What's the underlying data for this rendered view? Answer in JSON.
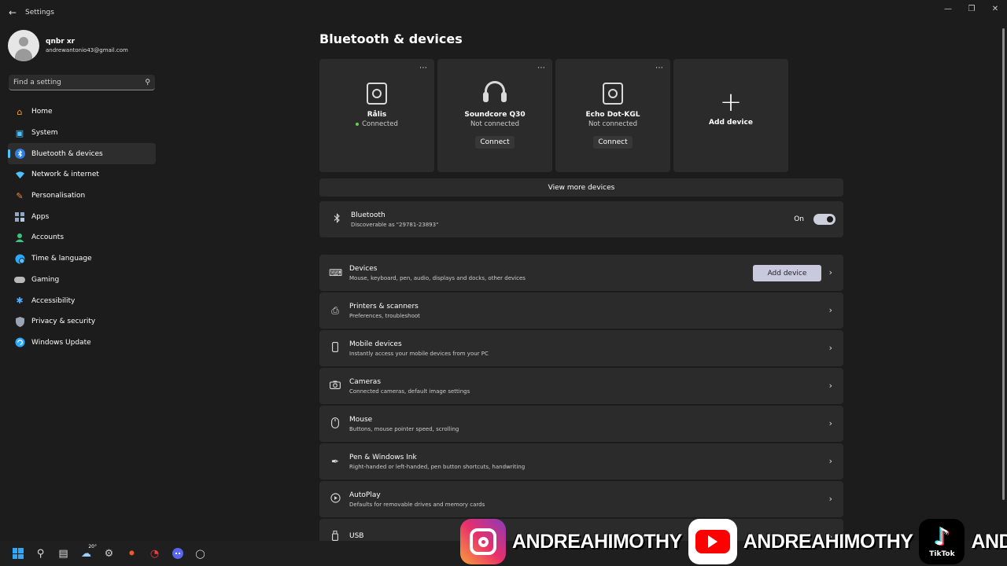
{
  "window": {
    "title": "Settings",
    "back_icon": "back-arrow-icon",
    "controls": [
      "minimize-icon",
      "maximize-icon",
      "close-icon"
    ]
  },
  "profile": {
    "name": "qnbr xr",
    "email": "andrewantonio43@gmail.com"
  },
  "search": {
    "placeholder": "Find a setting"
  },
  "sidebar": {
    "items": [
      {
        "label": "Home",
        "icon": "home-icon",
        "color": "#f0a030"
      },
      {
        "label": "System",
        "icon": "system-icon",
        "color": "#4cc2ff"
      },
      {
        "label": "Bluetooth & devices",
        "icon": "bluetooth-icon",
        "color": "#4c9fff",
        "active": true
      },
      {
        "label": "Network & internet",
        "icon": "wifi-icon",
        "color": "#4cc2ff"
      },
      {
        "label": "Personalisation",
        "icon": "brush-icon",
        "color": "#f08a40"
      },
      {
        "label": "Apps",
        "icon": "apps-icon",
        "color": "#8fa8c8"
      },
      {
        "label": "Accounts",
        "icon": "accounts-icon",
        "color": "#3cc47c"
      },
      {
        "label": "Time & language",
        "icon": "globe-clock-icon",
        "color": "#4cc2ff"
      },
      {
        "label": "Gaming",
        "icon": "gamepad-icon",
        "color": "#b8b8b8"
      },
      {
        "label": "Accessibility",
        "icon": "accessibility-icon",
        "color": "#4cb0ff"
      },
      {
        "label": "Privacy & security",
        "icon": "shield-icon",
        "color": "#9aa4b4"
      },
      {
        "label": "Windows Update",
        "icon": "update-icon",
        "color": "#2ea8ff"
      }
    ]
  },
  "main": {
    "title": "Bluetooth & devices",
    "devices": [
      {
        "name": "Rålis",
        "status": "Connected",
        "connected": true
      },
      {
        "name": "Soundcore Q30",
        "status": "Not connected",
        "button": "Connect"
      },
      {
        "name": "Echo Dot-KGL",
        "status": "Not connected",
        "button": "Connect"
      }
    ],
    "add_device_card": "Add device",
    "view_more": "View more devices",
    "bluetooth": {
      "title": "Bluetooth",
      "subtitle": "Discoverable as \"29781-23893\"",
      "state_label": "On",
      "on": true
    },
    "rows": [
      {
        "title": "Devices",
        "subtitle": "Mouse, keyboard, pen, audio, displays and docks, other devices",
        "icon": "devices-icon",
        "button": "Add device"
      },
      {
        "title": "Printers & scanners",
        "subtitle": "Preferences, troubleshoot",
        "icon": "printer-icon"
      },
      {
        "title": "Mobile devices",
        "subtitle": "Instantly access your mobile devices from your PC",
        "icon": "phone-icon"
      },
      {
        "title": "Cameras",
        "subtitle": "Connected cameras, default image settings",
        "icon": "camera-icon"
      },
      {
        "title": "Mouse",
        "subtitle": "Buttons, mouse pointer speed, scrolling",
        "icon": "mouse-icon"
      },
      {
        "title": "Pen & Windows Ink",
        "subtitle": "Right-handed or left-handed, pen button shortcuts, handwriting",
        "icon": "pen-icon"
      },
      {
        "title": "AutoPlay",
        "subtitle": "Defaults for removable drives and memory cards",
        "icon": "autoplay-icon"
      },
      {
        "title": "USB",
        "subtitle": "",
        "icon": "usb-icon"
      }
    ]
  },
  "taskbar": {
    "items": [
      "start-icon",
      "search-icon",
      "file-explorer-icon",
      "weather-icon",
      "settings-icon",
      "brave-icon",
      "app-icon",
      "discord-icon",
      "app2-icon"
    ],
    "weather_temp": "20°"
  },
  "overlay": {
    "instagram_handle": "ANDREAHIMOTHY",
    "youtube_handle": "ANDREAHIMOTHY",
    "tiktok_handle": "ANDREAHIMOTHY",
    "tiktok_label": "TikTok"
  }
}
